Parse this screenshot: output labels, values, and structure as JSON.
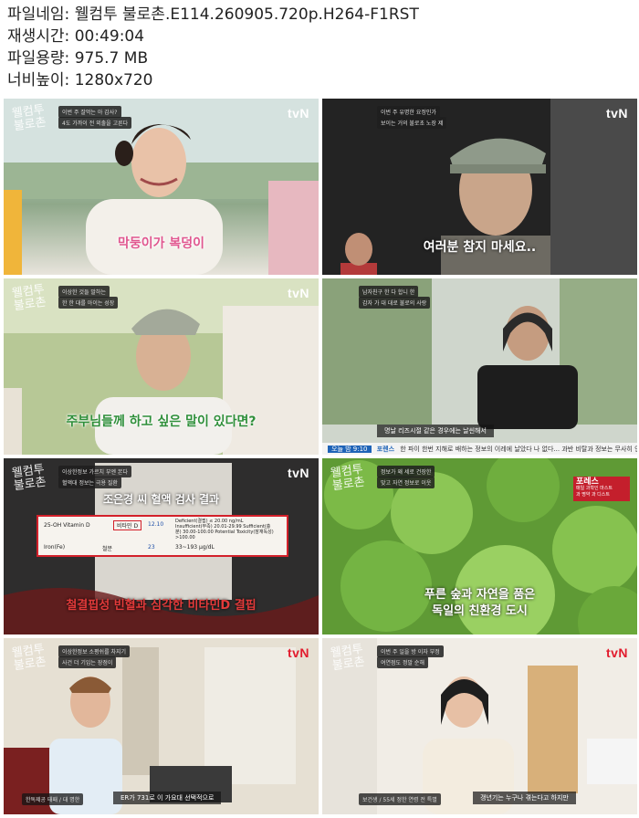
{
  "file_info": {
    "name_label": "파일네임:",
    "name_value": "웰컴투 불로촌.E114.260905.720p.H264-F1RST",
    "time_label": "재생시간:",
    "time_value": "00:49:04",
    "size_label": "파일용량:",
    "size_value": "975.7 MB",
    "res_label": "너비높이:",
    "res_value": "1280x720"
  },
  "frames": [
    {
      "channel": "tvN",
      "chip1": "이번 주 잘먹는 아 감사?",
      "chip2": "4도 가까이 전 외출을 고른다",
      "subtitle": "막둥이가 복덩이"
    },
    {
      "channel": "tvN",
      "chip1": "이번 주 유명한 요정인가",
      "chip2": "보이는 거의 불로초 노장 제",
      "subtitle": "여러분 참지 마세요.."
    },
    {
      "channel": "tvN",
      "chip1": "이상한 것들 말하는",
      "chip2": "한 한 대를 아이는 성장",
      "subtitle": "주부님들께 하고 싶은 말이 있다면?"
    },
    {
      "channel": "",
      "chip1": "남자친구 한 다 합니 한",
      "chip2": "감자 가 대 대로 불로의 사랑",
      "lower1": "명날 리즈시절 같은 경우에는 날씬해서",
      "ticker_label": "오늘 밤 9:10",
      "ticker_brand": "포렌스",
      "ticker_text": "한 파이 한번 지해로 배하는 정보의 이레에 날았다 나 없다... 과반 비탈과 정보는 무사히 연주를 끝까지도 오늘"
    },
    {
      "channel": "tvN",
      "chip1": "이상한정보 가르치 부엔 본다",
      "chip2": "혈액대 정보는 극용 질환",
      "title": "조은경 씨 혈액 검사 결과",
      "cell_label": "비타민 D",
      "cell_value": "12.10",
      "row1": "25-OH Vitamin D",
      "row2": "Iron(Fe)",
      "row2_tag": "철분",
      "row2_value": "23",
      "note": "Deficient(결핍) ≤ 20.00 ng/mL  Insufficient(부족) 20.01-29.99  Sufficient(충분) 30.00-100.00  Potential Toxicity(잠재독성) >100.00",
      "range": "33~193 μg/dL",
      "subtitle": "철결핍성 빈혈과 심각한 비타민D 결핍"
    },
    {
      "channel": "",
      "chip1": "정보가 왜 세로 건장한",
      "chip2": "맞고 자연 정보로 이웃",
      "badge_title": "포레스",
      "badge_line1": "매일 과학인 마스트",
      "badge_line2": "과 명약 과 디스트",
      "subtitle1": "푸른 숲과 자연을 품은",
      "subtitle2": "독일의 친환경 도시"
    },
    {
      "channel": "tvN",
      "chip1": "이상한정보 소평쉬를 차지기",
      "chip2": "사건 더 기입는 장점이",
      "lower1": "ER가 731로 이 가요대 선택적으로",
      "lower_tag": "한독제공 태패 / 대 명한"
    },
    {
      "channel": "tvN",
      "chip1": "이번 주 일을 방 이자 부정",
      "chip2": "여연점도 정말 순해",
      "lower1": "갱년기는 누구나 겪는다고 하지만",
      "lower_tag": "보건생 / 55세 정한 연령 전 특별"
    }
  ],
  "colors": {
    "tvn_red": "#e21b2d",
    "subtitle_green": "#2f8f3a",
    "subtitle_pink": "#e0568f"
  }
}
